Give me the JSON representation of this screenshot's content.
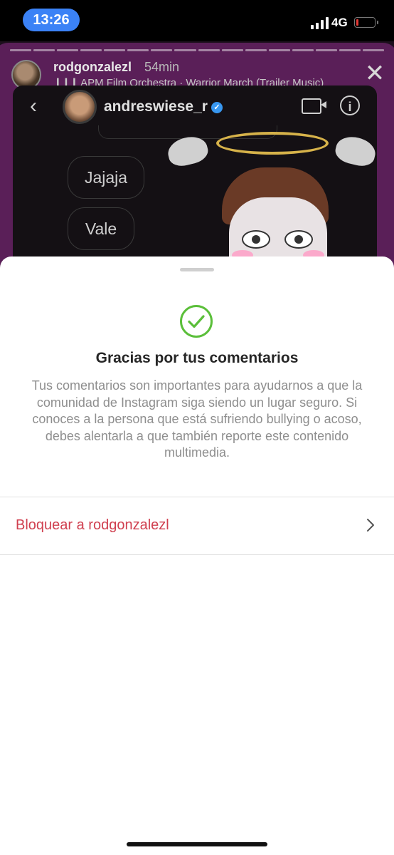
{
  "status_bar": {
    "time": "13:26",
    "network": "4G",
    "battery_level": 0.15,
    "battery_color": "#e53935"
  },
  "story": {
    "username": "rodgonzalezl",
    "time_ago": "54min",
    "music_icon": "audio-bars-icon",
    "music": "APM Film Orchestra · Warrior March (Trailer Music)",
    "close_icon": "close-icon",
    "dm": {
      "back_icon": "chevron-left-icon",
      "username": "andreswiese_r",
      "verified_icon": "verified-badge-icon",
      "video_icon": "video-call-icon",
      "info_icon": "info-icon",
      "messages": [
        "Jajaja",
        "Vale"
      ]
    }
  },
  "sheet": {
    "success_icon": "check-circle-icon",
    "success_color": "#5bbf3a",
    "title": "Gracias por tus comentarios",
    "body": "Tus comentarios son importantes para ayudarnos a que la comunidad de Instagram siga siendo un lugar seguro. Si conoces a la persona que está sufriendo bullying o acoso, debes alentarla a que también reporte este contenido multimedia.",
    "block_label": "Bloquear a rodgonzalezl",
    "block_color": "#d04050",
    "chevron_icon": "chevron-right-icon"
  }
}
